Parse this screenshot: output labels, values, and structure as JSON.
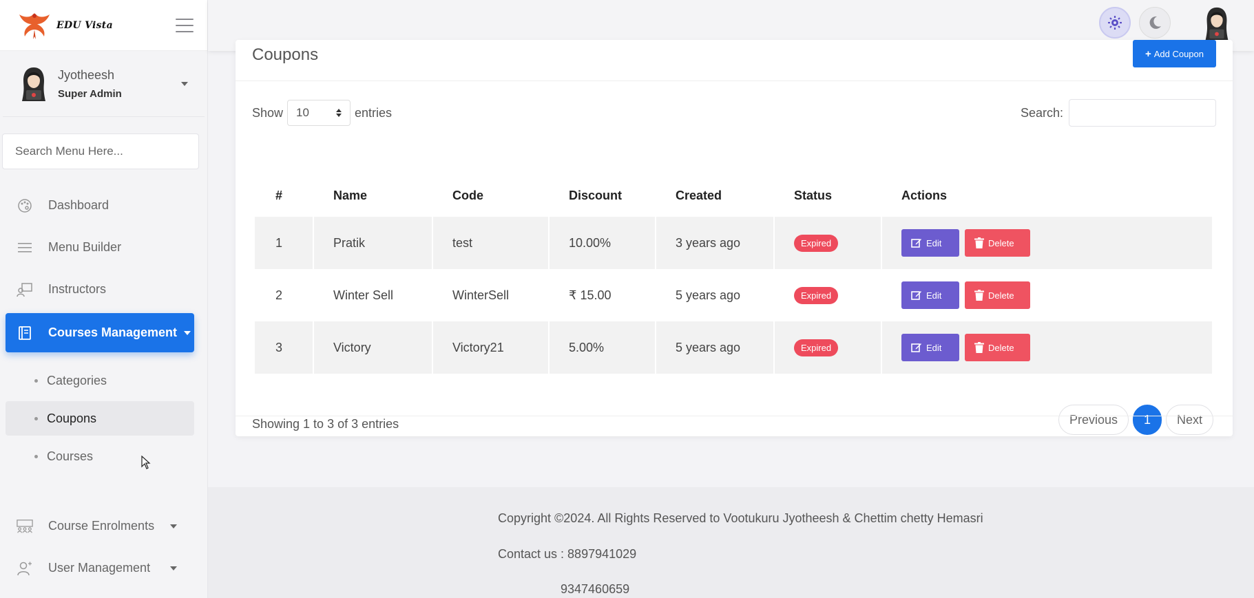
{
  "brand": {
    "name": "EDU Vista"
  },
  "user": {
    "name": "Jyotheesh",
    "role": "Super Admin"
  },
  "sidebar": {
    "search_placeholder": "Search Menu Here...",
    "items": [
      {
        "label": "Dashboard",
        "icon": "palette-icon"
      },
      {
        "label": "Menu Builder",
        "icon": "menu-icon"
      },
      {
        "label": "Instructors",
        "icon": "instructor-icon"
      },
      {
        "label": "Courses Management",
        "icon": "book-icon"
      },
      {
        "label": "Course Enrolments",
        "icon": "enrolment-icon"
      },
      {
        "label": "User Management",
        "icon": "user-management-icon"
      }
    ],
    "sub_items": [
      {
        "label": "Categories"
      },
      {
        "label": "Coupons"
      },
      {
        "label": "Courses"
      }
    ]
  },
  "page": {
    "title": "Coupons",
    "add_button": "Add Coupon",
    "show_label": "Show",
    "entries_value": "10",
    "entries_label": "entries",
    "search_label": "Search:",
    "search_value": ""
  },
  "table": {
    "columns": [
      "#",
      "Name",
      "Code",
      "Discount",
      "Created",
      "Status",
      "Actions"
    ],
    "rows": [
      {
        "num": "1",
        "name": "Pratik",
        "code": "test",
        "discount": "10.00%",
        "created": "3 years ago",
        "status": "Expired"
      },
      {
        "num": "2",
        "name": "Winter Sell",
        "code": "WinterSell",
        "discount": "₹ 15.00",
        "created": "5 years ago",
        "status": "Expired"
      },
      {
        "num": "3",
        "name": "Victory",
        "code": "Victory21",
        "discount": "5.00%",
        "created": "5 years ago",
        "status": "Expired"
      }
    ],
    "edit_label": "Edit",
    "delete_label": "Delete"
  },
  "pagination": {
    "info": "Showing 1 to 3 of 3 entries",
    "previous": "Previous",
    "current": "1",
    "next": "Next"
  },
  "footer": {
    "copyright": "Copyright ©2024. All Rights Reserved to  Vootukuru Jyotheesh & Chettim chetty Hemasri",
    "contact": "Contact us : 8897941029",
    "contact2": "9347460659"
  },
  "colors": {
    "primary": "#1a73e8",
    "edit": "#6c5ccf",
    "delete": "#ef5361",
    "badge": "#ee4b5c"
  }
}
